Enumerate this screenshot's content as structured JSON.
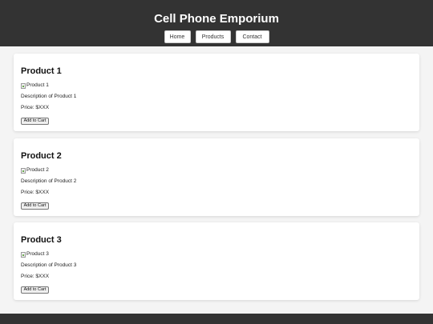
{
  "header": {
    "title": "Cell Phone Emporium",
    "nav": [
      {
        "label": "Home"
      },
      {
        "label": "Products"
      },
      {
        "label": "Contact"
      }
    ],
    "background": "#333333"
  },
  "products": [
    {
      "title": "Product 1",
      "image_alt": "Product 1",
      "description": "Description of Product 1",
      "price": "Price: $XXX",
      "button_label": "Add to Cart"
    },
    {
      "title": "Product 2",
      "image_alt": "Product 2",
      "description": "Description of Product 2",
      "price": "Price: $XXX",
      "button_label": "Add to Cart"
    },
    {
      "title": "Product 3",
      "image_alt": "Product 3",
      "description": "Description of Product 3",
      "price": "Price: $XXX",
      "button_label": "Add to Cart"
    }
  ],
  "icons": {
    "broken_image": "broken-image-icon"
  }
}
